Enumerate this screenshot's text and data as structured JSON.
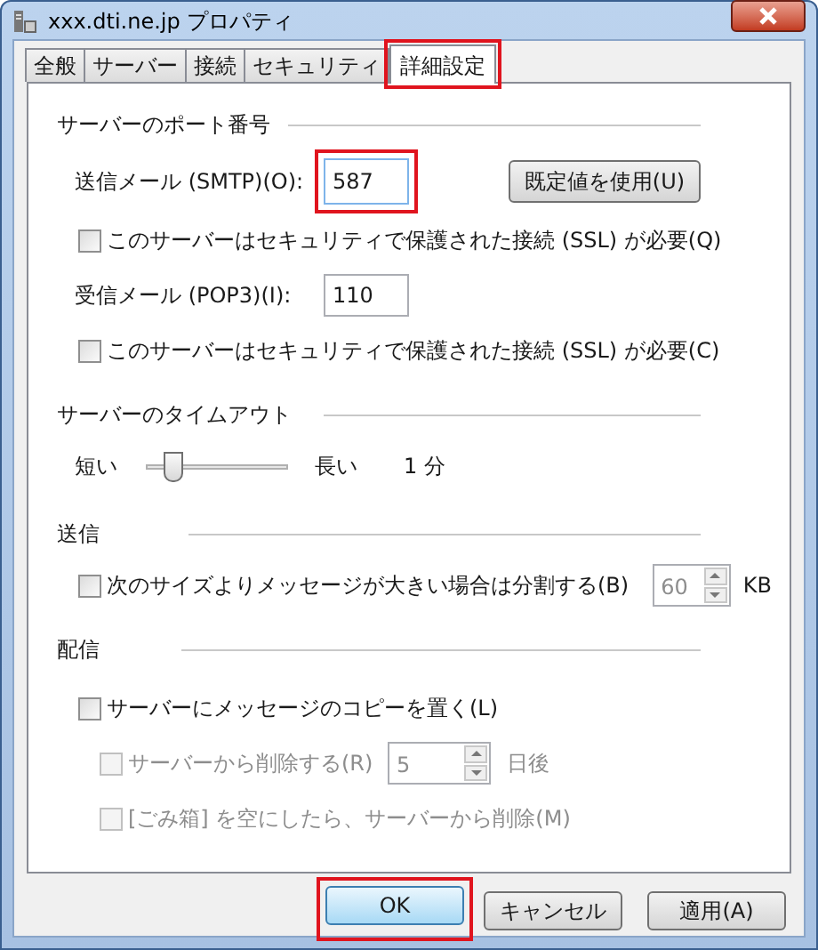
{
  "window": {
    "title": "xxx.dti.ne.jp プロパティ"
  },
  "tabs": [
    {
      "label": "全般",
      "selected": false,
      "highlighted": false
    },
    {
      "label": "サーバー",
      "selected": false,
      "highlighted": false
    },
    {
      "label": "接続",
      "selected": false,
      "highlighted": false
    },
    {
      "label": "セキュリティ",
      "selected": false,
      "highlighted": false
    },
    {
      "label": "詳細設定",
      "selected": true,
      "highlighted": true
    }
  ],
  "port_section": {
    "heading": "サーバーのポート番号",
    "smtp": {
      "label": "送信メール (SMTP)(O):",
      "value": "587",
      "highlighted": true
    },
    "default_button": "既定値を使用(U)",
    "smtp_ssl": {
      "label": "このサーバーはセキュリティで保護された接続 (SSL) が必要(Q)",
      "checked": false
    },
    "pop3": {
      "label": "受信メール (POP3)(I):",
      "value": "110"
    },
    "pop3_ssl": {
      "label": "このサーバーはセキュリティで保護された接続 (SSL) が必要(C)",
      "checked": false
    }
  },
  "timeout_section": {
    "heading": "サーバーのタイムアウト",
    "short_label": "短い",
    "long_label": "長い",
    "slider": {
      "level": 0.15
    },
    "reading": "1 分"
  },
  "sending_section": {
    "heading": "送信",
    "split": {
      "label": "次のサイズよりメッセージが大きい場合は分割する(B)",
      "checked": false,
      "value": "60",
      "value_disabled": true,
      "unit": "KB"
    }
  },
  "delivery_section": {
    "heading": "配信",
    "items": [
      {
        "label": "サーバーにメッセージのコピーを置く(L)",
        "checked": false,
        "disabled": false,
        "children": [
          {
            "label": "サーバーから削除する(R)",
            "checked": false,
            "disabled": true,
            "value": "5",
            "unit": "日後"
          },
          {
            "label": "[ごみ箱] を空にしたら、サーバーから削除(M)",
            "checked": false,
            "disabled": true
          }
        ]
      }
    ]
  },
  "buttons": [
    {
      "label": "OK",
      "default": true,
      "highlighted": true
    },
    {
      "label": "キャンセル",
      "default": false,
      "highlighted": false
    },
    {
      "label": "適用(A)",
      "default": false,
      "highlighted": false
    }
  ]
}
